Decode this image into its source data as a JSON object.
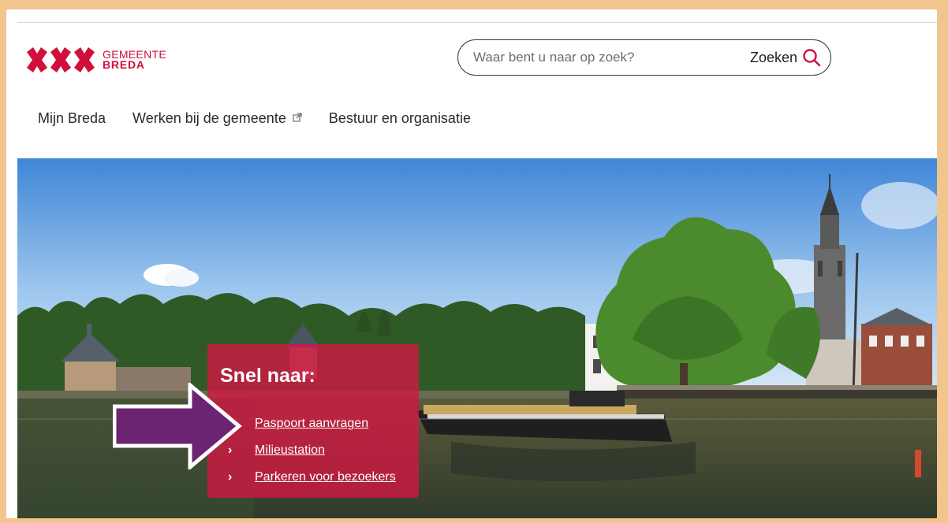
{
  "logo": {
    "line1": "GEMEENTE",
    "line2": "BREDA",
    "color": "#d0103a"
  },
  "search": {
    "placeholder": "Waar bent u naar op zoek?",
    "button_label": "Zoeken",
    "icon": "search-icon"
  },
  "nav": {
    "items": [
      {
        "label": "Mijn Breda"
      },
      {
        "label": "Werken bij de gemeente",
        "icon": "external-link-icon"
      },
      {
        "label": "Bestuur en organisatie"
      }
    ]
  },
  "quick_links": {
    "title": "Snel naar:",
    "items": [
      {
        "label": "Paspoort aanvragen"
      },
      {
        "label": "Milieustation"
      },
      {
        "label": "Parkeren voor bezoekers"
      }
    ],
    "color": "#cd1842"
  },
  "annotation": {
    "icon": "pointer-arrow",
    "color": "#6b2372"
  }
}
